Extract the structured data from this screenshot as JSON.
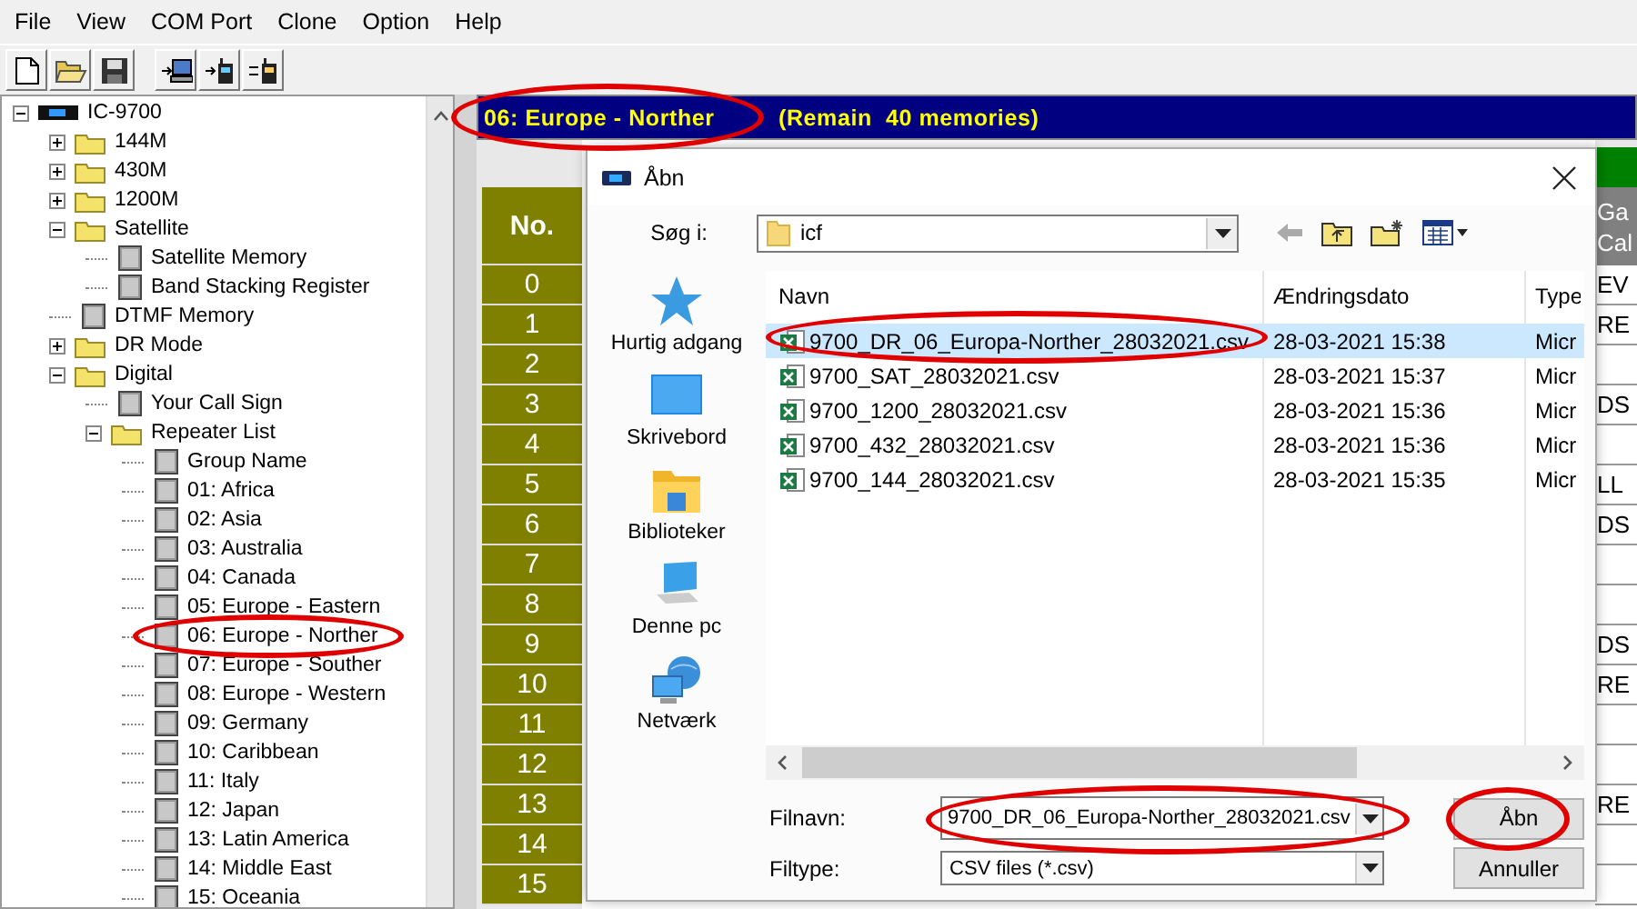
{
  "menu": [
    "File",
    "View",
    "COM Port",
    "Clone",
    "Option",
    "Help"
  ],
  "tree": [
    {
      "label": "IC-9700",
      "kind": "radio",
      "expanded": true,
      "highlighted": false,
      "children": [
        {
          "label": "144M",
          "kind": "folder",
          "expanded": false,
          "highlighted": false
        },
        {
          "label": "430M",
          "kind": "folder",
          "expanded": false,
          "highlighted": false
        },
        {
          "label": "1200M",
          "kind": "folder",
          "expanded": false,
          "highlighted": false
        },
        {
          "label": "Satellite",
          "kind": "folder",
          "expanded": true,
          "highlighted": false,
          "children": [
            {
              "label": "Satellite Memory",
              "kind": "memory",
              "highlighted": false
            },
            {
              "label": "Band Stacking Register",
              "kind": "memory",
              "highlighted": false
            }
          ]
        },
        {
          "label": "DTMF Memory",
          "kind": "memory",
          "highlighted": false
        },
        {
          "label": "DR Mode",
          "kind": "folder",
          "expanded": false,
          "highlighted": false
        },
        {
          "label": "Digital",
          "kind": "folder",
          "expanded": true,
          "highlighted": false,
          "children": [
            {
              "label": "Your Call Sign",
              "kind": "memory",
              "highlighted": false
            },
            {
              "label": "Repeater List",
              "kind": "folder",
              "expanded": true,
              "highlighted": false,
              "children": [
                {
                  "label": "Group Name",
                  "kind": "memory",
                  "highlighted": false
                },
                {
                  "label": "01: Africa",
                  "kind": "memory",
                  "highlighted": false
                },
                {
                  "label": "02: Asia",
                  "kind": "memory",
                  "highlighted": false
                },
                {
                  "label": "03: Australia",
                  "kind": "memory",
                  "highlighted": false
                },
                {
                  "label": "04: Canada",
                  "kind": "memory",
                  "highlighted": false
                },
                {
                  "label": "05: Europe - Eastern",
                  "kind": "memory",
                  "highlighted": false
                },
                {
                  "label": "06: Europe - Norther",
                  "kind": "memory",
                  "highlighted": true
                },
                {
                  "label": "07: Europe - Souther",
                  "kind": "memory",
                  "highlighted": false
                },
                {
                  "label": "08: Europe - Western",
                  "kind": "memory",
                  "highlighted": false
                },
                {
                  "label": "09: Germany",
                  "kind": "memory",
                  "highlighted": false
                },
                {
                  "label": "10: Caribbean",
                  "kind": "memory",
                  "highlighted": false
                },
                {
                  "label": "11: Italy",
                  "kind": "memory",
                  "highlighted": false
                },
                {
                  "label": "12: Japan",
                  "kind": "memory",
                  "highlighted": false
                },
                {
                  "label": "13: Latin America",
                  "kind": "memory",
                  "highlighted": false
                },
                {
                  "label": "14: Middle East",
                  "kind": "memory",
                  "highlighted": false
                },
                {
                  "label": "15: Oceania",
                  "kind": "memory",
                  "highlighted": false
                }
              ]
            }
          ]
        }
      ]
    }
  ],
  "group_header": {
    "name": "06: Europe - Norther",
    "remain": "(Remain  40 memories)",
    "highlighted": true
  },
  "memory_grid": {
    "no_header": "No.",
    "column_2_header": [
      "Ga",
      "Cal"
    ],
    "rows": [
      {
        "no": "0",
        "column_2": "EV"
      },
      {
        "no": "1",
        "column_2": "RE"
      },
      {
        "no": "2"
      },
      {
        "no": "3",
        "column_2": "DS"
      },
      {
        "no": "4"
      },
      {
        "no": "5",
        "column_2": "LL"
      },
      {
        "no": "6",
        "column_2": "DS"
      },
      {
        "no": "7"
      },
      {
        "no": "8"
      },
      {
        "no": "9",
        "column_2": "DS"
      },
      {
        "no": "10",
        "column_2": "RE"
      },
      {
        "no": "11"
      },
      {
        "no": "12"
      },
      {
        "no": "13",
        "column_2": "RE"
      },
      {
        "no": "14"
      },
      {
        "no": "15"
      }
    ]
  },
  "dialog": {
    "title": "Åbn",
    "look_in_label": "Søg i:",
    "look_in": "icf",
    "places": [
      {
        "label": "Hurtig adgang",
        "kind": "star"
      },
      {
        "label": "Skrivebord",
        "kind": "desktop"
      },
      {
        "label": "Biblioteker",
        "kind": "library"
      },
      {
        "label": "Denne pc",
        "kind": "pc"
      },
      {
        "label": "Netværk",
        "kind": "network"
      }
    ],
    "columns": [
      "Navn",
      "Ændringsdato",
      "Type"
    ],
    "files": [
      {
        "name": "9700_DR_06_Europa-Norther_28032021.csv",
        "date": "28-03-2021 15:38",
        "type": "Micr",
        "selected": true,
        "highlighted": true
      },
      {
        "name": "9700_SAT_28032021.csv",
        "date": "28-03-2021 15:37",
        "type": "Micr",
        "selected": false,
        "highlighted": false
      },
      {
        "name": "9700_1200_28032021.csv",
        "date": "28-03-2021 15:36",
        "type": "Micr",
        "selected": false,
        "highlighted": false
      },
      {
        "name": "9700_432_28032021.csv",
        "date": "28-03-2021 15:36",
        "type": "Micr",
        "selected": false,
        "highlighted": false
      },
      {
        "name": "9700_144_28032021.csv",
        "date": "28-03-2021 15:35",
        "type": "Micr",
        "selected": false,
        "highlighted": false
      }
    ],
    "filename_label": "Filnavn:",
    "filename": {
      "value": "9700_DR_06_Europa-Norther_28032021.csv",
      "highlighted": true
    },
    "filetype_label": "Filtype:",
    "filetype": "CSV files (*.csv)",
    "buttons": [
      {
        "label": "Åbn",
        "highlighted": true
      },
      {
        "label": "Annuller",
        "highlighted": false
      }
    ]
  }
}
